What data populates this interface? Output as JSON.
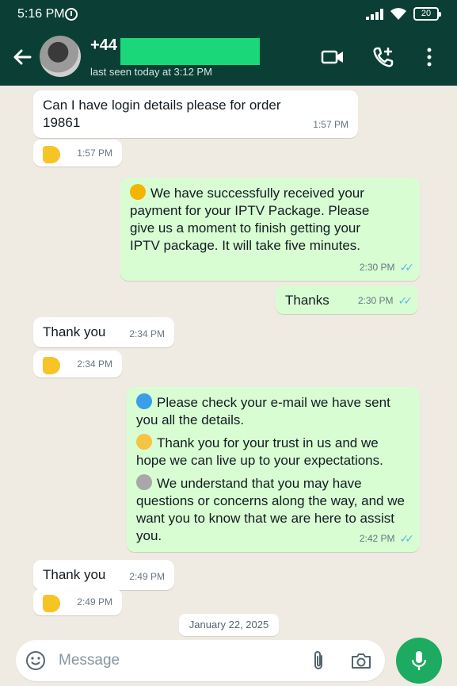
{
  "status_bar": {
    "time": "5:16 PM",
    "battery": "20"
  },
  "header": {
    "contact_name": "+44",
    "last_seen": "last seen today at 3:12 PM"
  },
  "messages": [
    {
      "dir": "in",
      "text": "Can I have login details please for order 19861",
      "time": "1:57 PM"
    },
    {
      "dir": "in",
      "emoji": "thumbs-up-emoji",
      "time": "1:57 PM"
    },
    {
      "dir": "out",
      "emoji": "waving-hand-emoji",
      "text": "We have successfully received your payment for your IPTV Package. Please give us a moment to finish getting your IPTV package. It will take five minutes.",
      "time": "2:30 PM"
    },
    {
      "dir": "out",
      "text": "Thanks",
      "time": "2:30 PM"
    },
    {
      "dir": "in",
      "text": "Thank you",
      "time": "2:34 PM"
    },
    {
      "dir": "in",
      "emoji": "thumbs-up-emoji",
      "time": "2:34 PM"
    },
    {
      "dir": "out",
      "paragraphs": [
        {
          "emoji": "blue-heart-emoji",
          "text": "Please check your e-mail we have sent you all the details."
        },
        {
          "emoji": "smiling-face-emoji",
          "text": "Thank you for your trust in us and we hope we can live up to your expectations."
        },
        {
          "emoji": "gear-emoji",
          "text": "We understand that you may have questions or concerns along the way, and we want you to know that we are here to assist you."
        }
      ],
      "time": "2:42 PM"
    },
    {
      "dir": "in",
      "text": "Thank you",
      "time": "2:49 PM"
    },
    {
      "dir": "in",
      "emoji": "thumbs-up-emoji",
      "time": "2:49 PM"
    }
  ],
  "date_chip": "January 22, 2025",
  "composer": {
    "placeholder": "Message"
  },
  "colors": {
    "header": "#0b3f35",
    "incoming": "#ffffff",
    "outgoing": "#d9fdd3",
    "background": "#efeae2",
    "mic": "#1daa61",
    "read_ticks": "#53bdeb"
  }
}
